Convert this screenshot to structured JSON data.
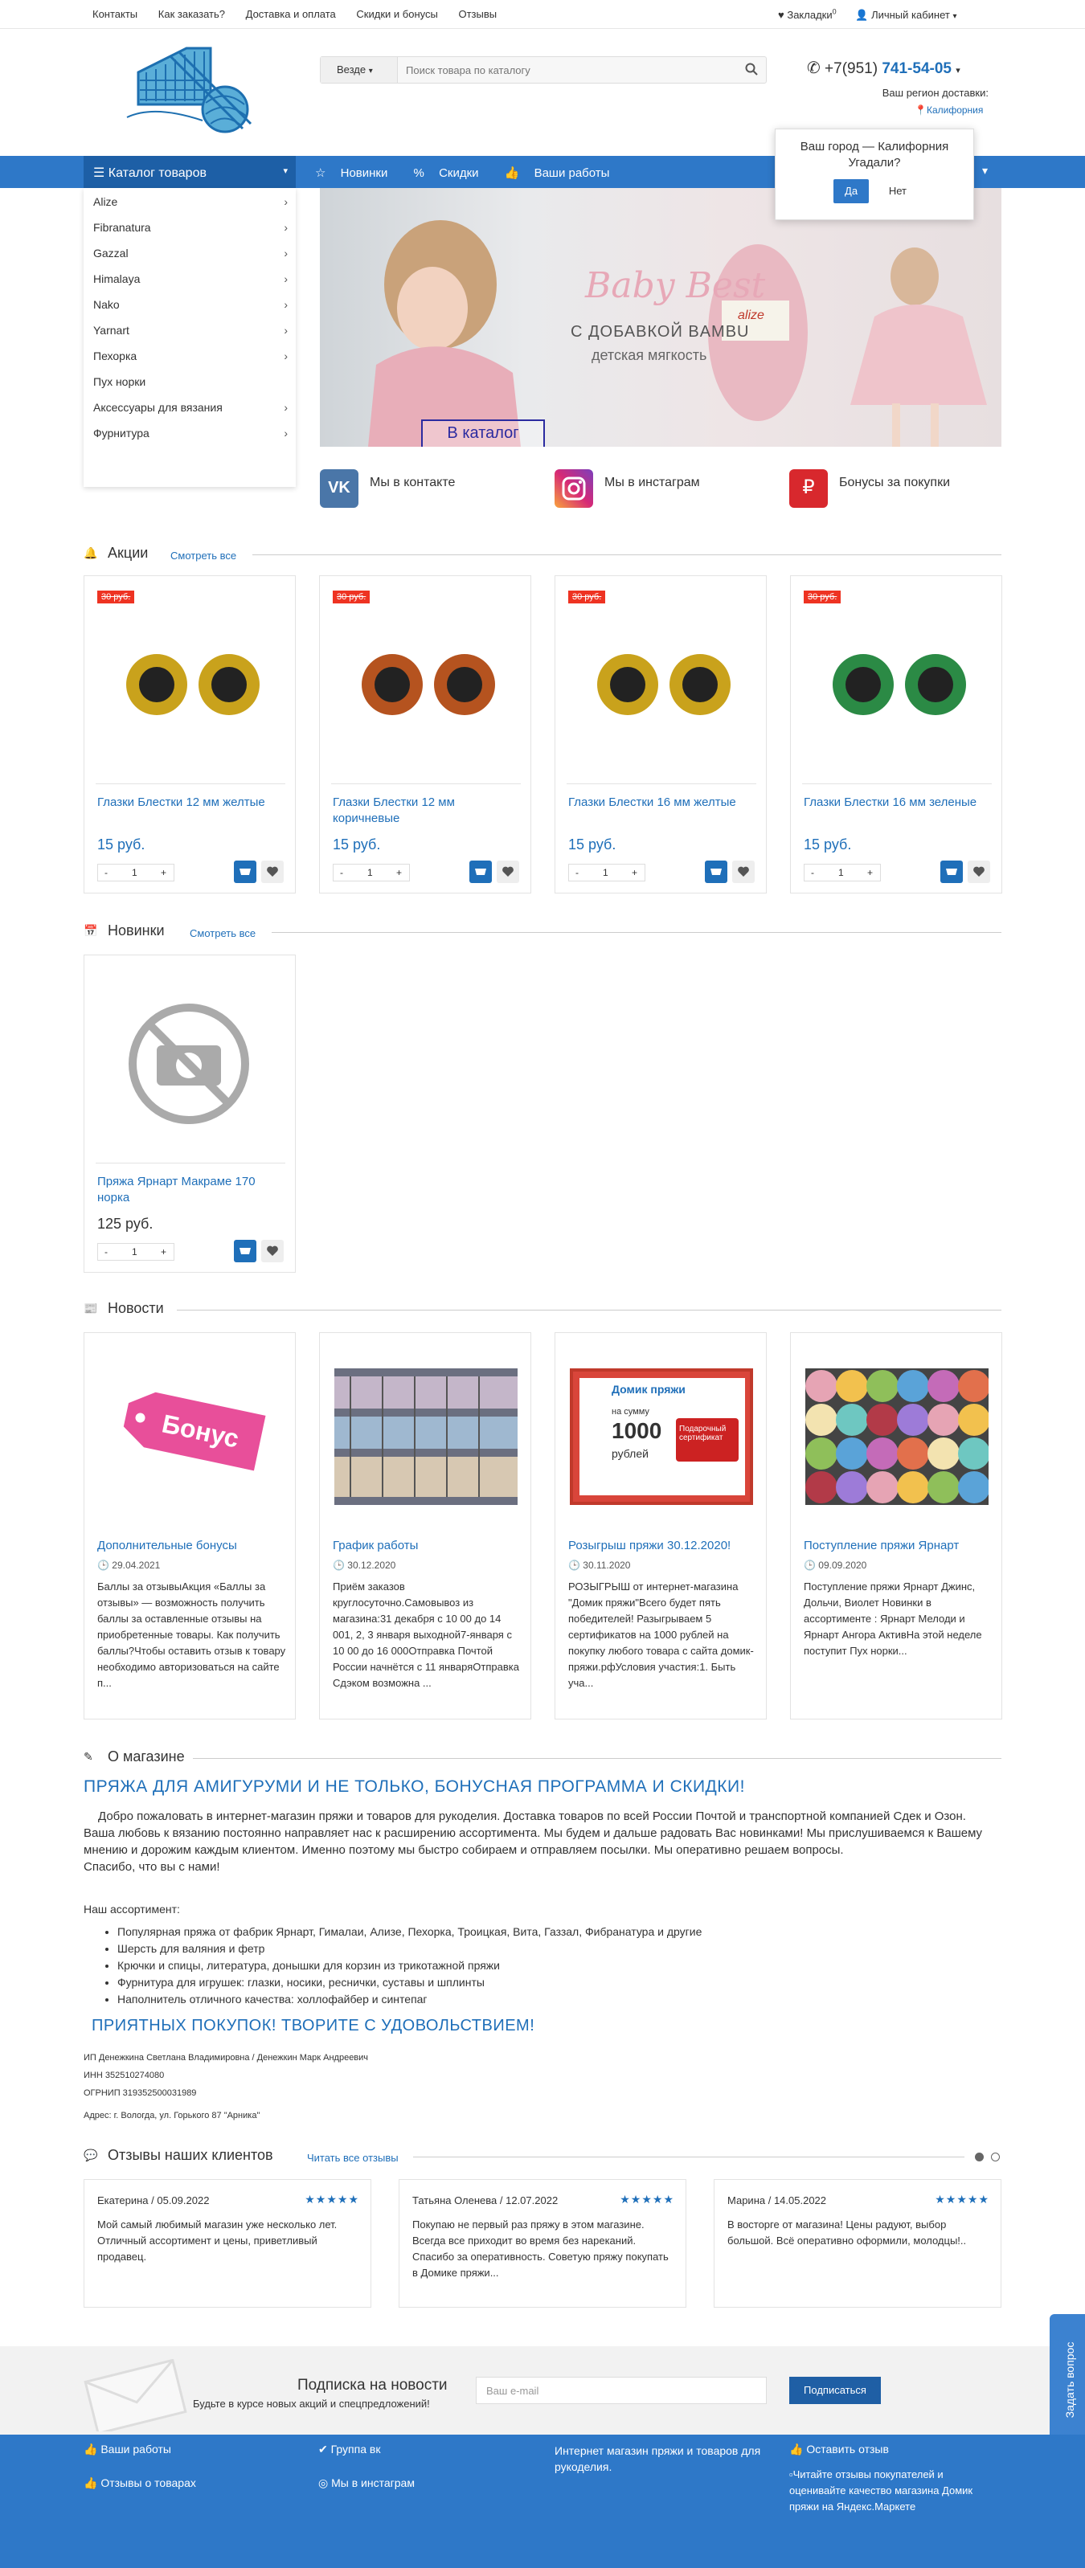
{
  "topbar": {
    "links": [
      "Контакты",
      "Как заказать?",
      "Доставка и оплата",
      "Скидки и бонусы",
      "Отзывы"
    ],
    "bookmarks": "Закладки",
    "bookmarks_count": "0",
    "account": "Личный кабинет"
  },
  "search": {
    "scope": "Везде",
    "placeholder": "Поиск товара по каталогу"
  },
  "phone": {
    "prefix": "+7(951)",
    "number": "741-54-05"
  },
  "region": {
    "label": "Ваш регион доставки:",
    "city": "Калифорния"
  },
  "nav": {
    "catalog": "Каталог товаров",
    "items": [
      "Новинки",
      "Скидки",
      "Ваши работы"
    ],
    "more": "Еще"
  },
  "city_popup": {
    "question": "Ваш город — Калифорния",
    "question2": "Угадали?",
    "yes": "Да",
    "no": "Нет"
  },
  "catalog": [
    {
      "label": "Alize",
      "arrow": true
    },
    {
      "label": "Fibranatura",
      "arrow": true
    },
    {
      "label": "Gazzal",
      "arrow": true
    },
    {
      "label": "Himalaya",
      "arrow": true
    },
    {
      "label": "Nako",
      "arrow": true
    },
    {
      "label": "Yarnart",
      "arrow": true
    },
    {
      "label": "Пехорка",
      "arrow": true
    },
    {
      "label": "Пух норки",
      "arrow": false
    },
    {
      "label": "Аксессуары для вязания",
      "arrow": true
    },
    {
      "label": "Фурнитура",
      "arrow": true
    }
  ],
  "banner": {
    "brand": "Baby Best",
    "line1": "С ДОБАВКОЙ BAMBU",
    "line2": "детская мягкость",
    "label": "alize",
    "cta": "В каталог"
  },
  "social": [
    {
      "label": "Мы в контакте",
      "icon": "vk-icon",
      "color": "#4a76a8"
    },
    {
      "label": "Мы в инстаграм",
      "icon": "instagram-icon",
      "color": "#c13584"
    },
    {
      "label": "Бонусы за покупки",
      "icon": "ruble-icon",
      "color": "#d8282d"
    }
  ],
  "sales": {
    "title": "Акции",
    "see_all": "Смотреть все",
    "products": [
      {
        "old": "30 руб.",
        "name": "Глазки Блестки 12 мм желтые",
        "price": "15 руб.",
        "qty": "1",
        "color": "#c9a21c"
      },
      {
        "old": "30 руб.",
        "name": "Глазки Блестки 12 мм коричневые",
        "price": "15 руб.",
        "qty": "1",
        "color": "#b5531f"
      },
      {
        "old": "30 руб.",
        "name": "Глазки Блестки 16 мм желтые",
        "price": "15 руб.",
        "qty": "1",
        "color": "#c9a21c"
      },
      {
        "old": "30 руб.",
        "name": "Глазки Блестки 16 мм зеленые",
        "price": "15 руб.",
        "qty": "1",
        "color": "#2b8a45"
      }
    ]
  },
  "new": {
    "title": "Новинки",
    "see_all": "Смотреть все",
    "products": [
      {
        "name": "Пряжа Ярнарт Макраме 170 норка",
        "price": "125 руб.",
        "qty": "1"
      }
    ]
  },
  "news": {
    "title": "Новости",
    "items": [
      {
        "title": "Дополнительные бонусы",
        "date": "29.04.2021",
        "text": "Баллы за отзывыАкция «Баллы за отзывы» — возможность получить баллы за оставленные отзывы на приобретенные товары. Как получить баллы?Чтобы оставить отзыв к товару необходимо авторизоваться на сайте п...",
        "tag": "Бонус"
      },
      {
        "title": "График работы",
        "date": "30.12.2020",
        "text": "Приём заказов круглосуточно.Самовывоз из магазина:31 декабря с 10 00 до 14 001, 2, 3 января выходной7-января с 10 00 до 16 000Отправка Почтой России начнётся с 11 январяОтправка Сдэком возможна ..."
      },
      {
        "title": "Розыгрыш пряжи 30.12.2020!",
        "date": "30.11.2020",
        "text": "РОЗЫГРЫШ от интернет-магазина \"Домик пряжи\"Всего будет пять победителей! Разыгрываем 5 сертификатов на 1000 рублей на покупку любого товара с сайта домик-пряжи.рфУсловия участия:1. Быть уча...",
        "cert_head": "Домик пряжи",
        "cert_sum": "на сумму",
        "cert_val": "1000",
        "cert_cur": "рублей",
        "cert_note": "Подарочный сертификат"
      },
      {
        "title": "Поступление пряжи Ярнарт",
        "date": "09.09.2020",
        "text": "Поступление пряжи Ярнарт Джинс, Дольчи, Виолет Новинки в ассортименте : Ярнарт Мелоди и Ярнарт Ангора АктивНа этой неделе поступит Пух норки..."
      }
    ]
  },
  "about": {
    "title": "О магазине",
    "heading": "ПРЯЖА ДЛЯ АМИГУРУМИ И НЕ ТОЛЬКО, БОНУСНАЯ ПРОГРАММА И СКИДКИ!",
    "paragraph": "Добро пожаловать в интернет-магазин пряжи и товаров для рукоделия. Доставка товаров по всей России Почтой и транспортной компанией Сдек и Озон. Ваша любовь к вязанию постоянно направляет нас к расширению ассортимента. Мы будем и дальше радовать Вас новинками! Мы прислушиваемся к Вашему мнению и дорожим каждым клиентом. Именно поэтому мы быстро собираем и отправляем посылки. Мы оперативно решаем вопросы.",
    "thanks": "Спасибо, что вы с нами!",
    "assortment": "Наш ассортимент:",
    "list": [
      "Популярная пряжа от фабрик Ярнарт, Гималаи, Ализе, Пехорка, Троицкая, Вита, Газзал, Фибранатура и другие",
      "Шерсть для валяния и фетр",
      "Крючки и спицы, литература, донышки для корзин из трикотажной пряжи",
      "Фурнитура для игрушек: глазки, носики, реснички, суставы и шплинты",
      "Наполнитель отличного качества: холлофайбер и синтепаг"
    ],
    "heading2": "ПРИЯТНЫХ ПОКУПОК! ТВОРИТЕ С УДОВОЛЬСТВИЕМ!",
    "requisites": [
      "ИП Денежкина Светлана Владимировна / Денежкин Марк Андреевич",
      "ИНН 352510274080",
      "ОГРНИП 319352500031989",
      "Адрес: г. Вологда, ул. Горького 87 \"Арника\""
    ]
  },
  "reviews": {
    "title": "Отзывы наших клиентов",
    "read_all": "Читать все отзывы",
    "stars": "★★★★★",
    "items": [
      {
        "author": "Екатерина / 05.09.2022",
        "text": "Мой самый любимый магазин уже несколько лет. Отличный ассортимент и цены, приветливый продавец."
      },
      {
        "author": "Татьяна Оленева / 12.07.2022",
        "text": "Покупаю не первый раз пряжу в этом магазине. Всегда все приходит во время без нареканий. Спасибо за оперативность. Советую пряжу покупать в Домике пряжи..."
      },
      {
        "author": "Марина / 14.05.2022",
        "text": "В восторге от магазина! Цены радуют, выбор большой. Всё оперативно оформили, молодцы!.."
      }
    ]
  },
  "subscribe": {
    "title": "Подписка на новости",
    "subtitle": "Будьте в курсе новых акций и спецпредложений!",
    "placeholder": "Ваш e-mail",
    "button": "Подписаться"
  },
  "ask": "Задать вопрос",
  "footer": {
    "works": "Ваши работы",
    "vk": "Группа вк",
    "reviews": "Отзывы о товарах",
    "insta": "Мы в инстаграм",
    "about": "Интернет магазин пряжи и товаров для рукоделия.",
    "leave": "Оставить отзыв",
    "market": "Читайте отзывы покупателей и оценивайте качество магазина Домик пряжи на Яндекс.Маркете"
  }
}
